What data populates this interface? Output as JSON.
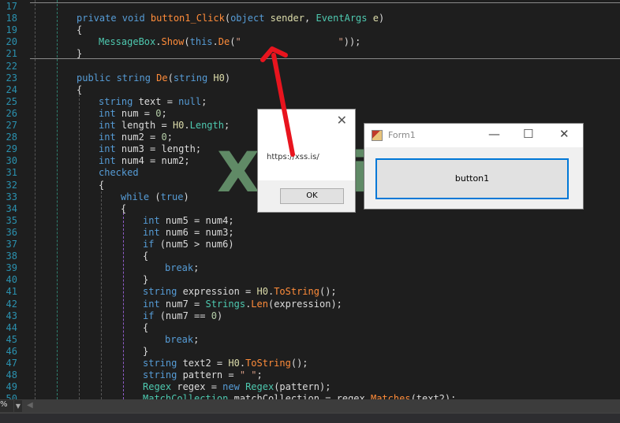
{
  "editor": {
    "lines": [
      {
        "n": "17",
        "i": 0,
        "tk": []
      },
      {
        "n": "18",
        "i": 1,
        "tk": [
          [
            "k",
            "private "
          ],
          [
            "k",
            "void "
          ],
          [
            "m",
            "button1_Click"
          ],
          [
            "v",
            "("
          ],
          [
            "k",
            "object "
          ],
          [
            "p",
            "sender"
          ],
          [
            "v",
            ", "
          ],
          [
            "t",
            "EventArgs "
          ],
          [
            "p",
            "e"
          ],
          [
            "v",
            ")"
          ]
        ]
      },
      {
        "n": "19",
        "i": 1,
        "tk": [
          [
            "v",
            "{"
          ]
        ]
      },
      {
        "n": "20",
        "i": 2,
        "tk": [
          [
            "t",
            "MessageBox"
          ],
          [
            "v",
            "."
          ],
          [
            "m",
            "Show"
          ],
          [
            "v",
            "("
          ],
          [
            "k",
            "this"
          ],
          [
            "v",
            "."
          ],
          [
            "m",
            "De"
          ],
          [
            "v",
            "("
          ],
          [
            "s",
            "\"                 \""
          ],
          [
            "v",
            "));"
          ]
        ]
      },
      {
        "n": "21",
        "i": 1,
        "tk": [
          [
            "v",
            "}"
          ]
        ]
      },
      {
        "n": "22",
        "i": 0,
        "tk": []
      },
      {
        "n": "23",
        "i": 1,
        "tk": [
          [
            "k",
            "public "
          ],
          [
            "k",
            "string "
          ],
          [
            "m",
            "De"
          ],
          [
            "v",
            "("
          ],
          [
            "k",
            "string "
          ],
          [
            "p",
            "H0"
          ],
          [
            "v",
            ")"
          ]
        ]
      },
      {
        "n": "24",
        "i": 1,
        "tk": [
          [
            "v",
            "{"
          ]
        ]
      },
      {
        "n": "25",
        "i": 2,
        "tk": [
          [
            "k",
            "string "
          ],
          [
            "v",
            "text = "
          ],
          [
            "k",
            "null"
          ],
          [
            "v",
            ";"
          ]
        ]
      },
      {
        "n": "26",
        "i": 2,
        "tk": [
          [
            "k",
            "int "
          ],
          [
            "v",
            "num = "
          ],
          [
            "n",
            "0"
          ],
          [
            "v",
            ";"
          ]
        ]
      },
      {
        "n": "27",
        "i": 2,
        "tk": [
          [
            "k",
            "int "
          ],
          [
            "v",
            "length = "
          ],
          [
            "p",
            "H0"
          ],
          [
            "v",
            "."
          ],
          [
            "t",
            "Length"
          ],
          [
            "v",
            ";"
          ]
        ]
      },
      {
        "n": "28",
        "i": 2,
        "tk": [
          [
            "k",
            "int "
          ],
          [
            "v",
            "num2 = "
          ],
          [
            "n",
            "0"
          ],
          [
            "v",
            ";"
          ]
        ]
      },
      {
        "n": "29",
        "i": 2,
        "tk": [
          [
            "k",
            "int "
          ],
          [
            "v",
            "num3 = length;"
          ]
        ]
      },
      {
        "n": "30",
        "i": 2,
        "tk": [
          [
            "k",
            "int "
          ],
          [
            "v",
            "num4 = num2;"
          ]
        ]
      },
      {
        "n": "31",
        "i": 2,
        "tk": [
          [
            "k",
            "checked"
          ]
        ]
      },
      {
        "n": "32",
        "i": 2,
        "tk": [
          [
            "v",
            "{"
          ]
        ]
      },
      {
        "n": "33",
        "i": 3,
        "tk": [
          [
            "k",
            "while "
          ],
          [
            "v",
            "("
          ],
          [
            "k",
            "true"
          ],
          [
            "v",
            ")"
          ]
        ]
      },
      {
        "n": "34",
        "i": 3,
        "tk": [
          [
            "v",
            "{"
          ]
        ]
      },
      {
        "n": "35",
        "i": 4,
        "tk": [
          [
            "k",
            "int "
          ],
          [
            "v",
            "num5 = num4;"
          ]
        ]
      },
      {
        "n": "36",
        "i": 4,
        "tk": [
          [
            "k",
            "int "
          ],
          [
            "v",
            "num6 = num3;"
          ]
        ]
      },
      {
        "n": "37",
        "i": 4,
        "tk": [
          [
            "k",
            "if "
          ],
          [
            "v",
            "(num5 > num6)"
          ]
        ]
      },
      {
        "n": "38",
        "i": 4,
        "tk": [
          [
            "v",
            "{"
          ]
        ]
      },
      {
        "n": "39",
        "i": 5,
        "tk": [
          [
            "k",
            "break"
          ],
          [
            "v",
            ";"
          ]
        ]
      },
      {
        "n": "40",
        "i": 4,
        "tk": [
          [
            "v",
            "}"
          ]
        ]
      },
      {
        "n": "41",
        "i": 4,
        "tk": [
          [
            "k",
            "string "
          ],
          [
            "v",
            "expression = "
          ],
          [
            "p",
            "H0"
          ],
          [
            "v",
            "."
          ],
          [
            "m",
            "ToString"
          ],
          [
            "v",
            "();"
          ]
        ]
      },
      {
        "n": "42",
        "i": 4,
        "tk": [
          [
            "k",
            "int "
          ],
          [
            "v",
            "num7 = "
          ],
          [
            "t",
            "Strings"
          ],
          [
            "v",
            "."
          ],
          [
            "m",
            "Len"
          ],
          [
            "v",
            "(expression);"
          ]
        ]
      },
      {
        "n": "43",
        "i": 4,
        "tk": [
          [
            "k",
            "if "
          ],
          [
            "v",
            "(num7 == "
          ],
          [
            "n",
            "0"
          ],
          [
            "v",
            ")"
          ]
        ]
      },
      {
        "n": "44",
        "i": 4,
        "tk": [
          [
            "v",
            "{"
          ]
        ]
      },
      {
        "n": "45",
        "i": 5,
        "tk": [
          [
            "k",
            "break"
          ],
          [
            "v",
            ";"
          ]
        ]
      },
      {
        "n": "46",
        "i": 4,
        "tk": [
          [
            "v",
            "}"
          ]
        ]
      },
      {
        "n": "47",
        "i": 4,
        "tk": [
          [
            "k",
            "string "
          ],
          [
            "v",
            "text2 = "
          ],
          [
            "p",
            "H0"
          ],
          [
            "v",
            "."
          ],
          [
            "m",
            "ToString"
          ],
          [
            "v",
            "();"
          ]
        ]
      },
      {
        "n": "48",
        "i": 4,
        "tk": [
          [
            "k",
            "string "
          ],
          [
            "v",
            "pattern = "
          ],
          [
            "s",
            "\" \""
          ],
          [
            "v",
            ";"
          ]
        ]
      },
      {
        "n": "49",
        "i": 4,
        "tk": [
          [
            "t",
            "Regex "
          ],
          [
            "v",
            "regex = "
          ],
          [
            "k",
            "new "
          ],
          [
            "t",
            "Regex"
          ],
          [
            "v",
            "(pattern);"
          ]
        ]
      },
      {
        "n": "50",
        "i": 4,
        "tk": [
          [
            "t",
            "MatchCollection "
          ],
          [
            "v",
            "matchCollection = regex."
          ],
          [
            "m",
            "Matches"
          ],
          [
            "v",
            "(text2);"
          ]
        ]
      }
    ]
  },
  "message_box": {
    "text": "https://xss.is/",
    "ok_label": "OK",
    "close_glyph": "✕"
  },
  "form1": {
    "title": "Form1",
    "button_label": "button1",
    "minimize_glyph": "—",
    "maximize_glyph": "☐",
    "close_glyph": "✕"
  },
  "watermark": "XSS.is",
  "status": {
    "zoom_label": "%",
    "dropdown_glyph": "▼",
    "scroll_glyph": "◀"
  },
  "colors": {
    "keyword": "#569cd6",
    "type": "#4ec9b0",
    "method": "#ff8c3a",
    "arrow": "#e8141e",
    "focus": "#0078d7"
  }
}
